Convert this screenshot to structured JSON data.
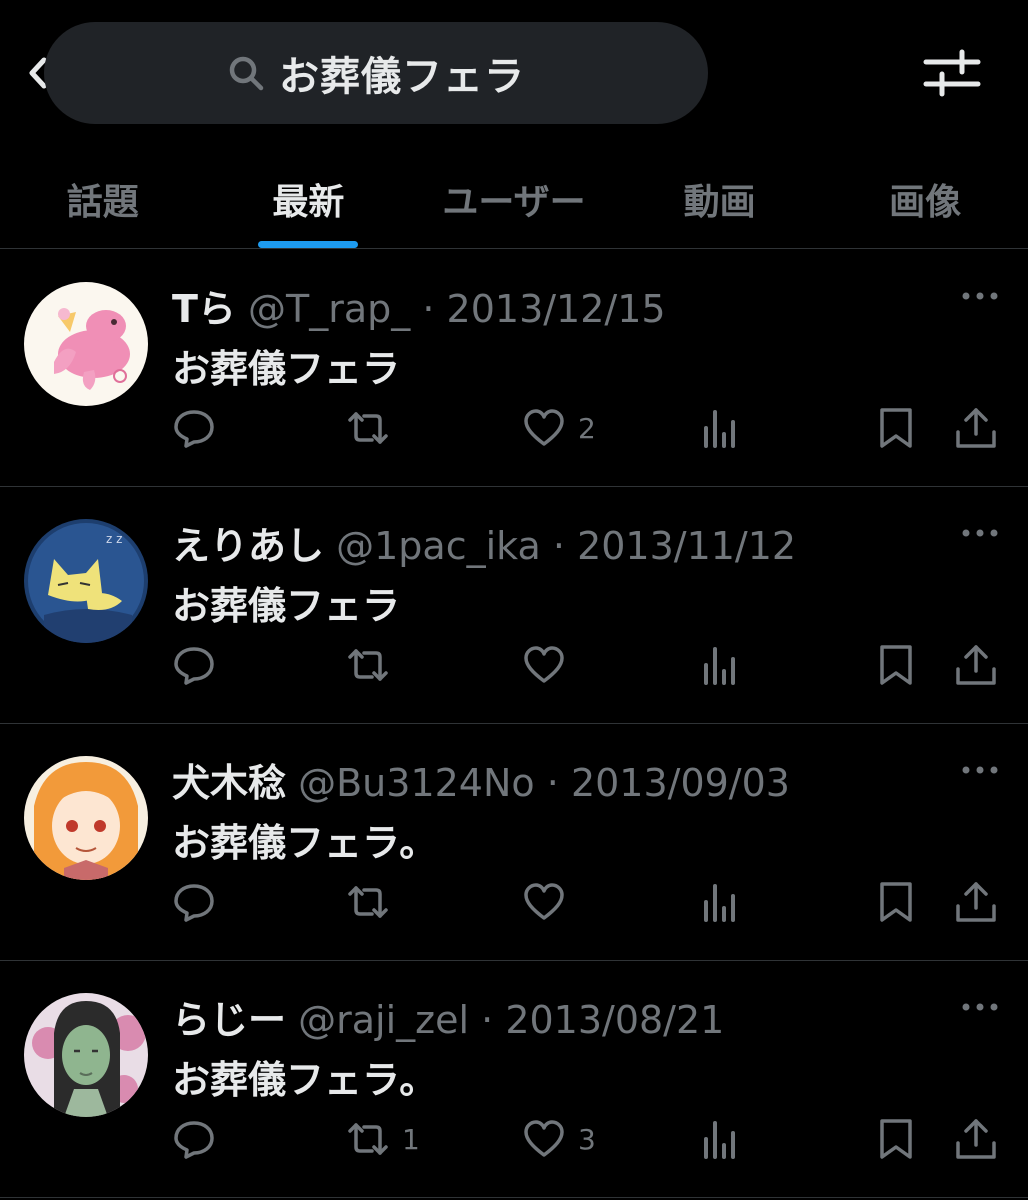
{
  "search": {
    "query": "お葬儀フェラ"
  },
  "tabs": [
    {
      "label": "話題",
      "active": false
    },
    {
      "label": "最新",
      "active": true
    },
    {
      "label": "ユーザー",
      "active": false
    },
    {
      "label": "動画",
      "active": false
    },
    {
      "label": "画像",
      "active": false
    }
  ],
  "colors": {
    "accent": "#1d9bf0",
    "muted": "#71767b",
    "text": "#e7e9ea",
    "bg": "#000000"
  },
  "tweets": [
    {
      "name": "Tら",
      "handle": "@T_rap_",
      "dot": "·",
      "date": "2013/12/15",
      "text": "お葬儀フェラ",
      "reply_count": "",
      "retweet_count": "",
      "like_count": "2",
      "avatar": "pink-animal-avatar"
    },
    {
      "name": "えりあし",
      "handle": "@1pac_ika",
      "dot": "·",
      "date": "2013/11/12",
      "text": "お葬儀フェラ",
      "reply_count": "",
      "retweet_count": "",
      "like_count": "",
      "avatar": "sleeping-cat-avatar"
    },
    {
      "name": "犬木稔",
      "handle": "@Bu3124No",
      "dot": "·",
      "date": "2013/09/03",
      "text": "お葬儀フェラ。",
      "reply_count": "",
      "retweet_count": "",
      "like_count": "",
      "avatar": "orange-hair-girl-avatar"
    },
    {
      "name": "らじー",
      "handle": "@raji_zel",
      "dot": "·",
      "date": "2013/08/21",
      "text": "お葬儀フェラ。",
      "reply_count": "",
      "retweet_count": "1",
      "like_count": "3",
      "avatar": "green-face-avatar"
    }
  ]
}
